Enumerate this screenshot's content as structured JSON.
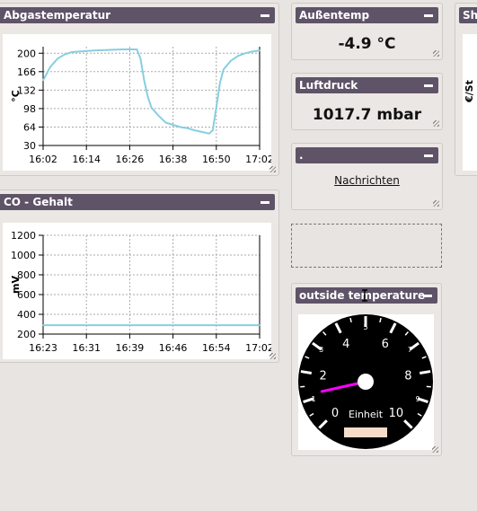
{
  "widgets": {
    "abgas": {
      "title": "Abgastemperatur"
    },
    "co": {
      "title": "CO - Gehalt"
    },
    "aussen": {
      "title": "Außentemp",
      "value": "-4.9 °C"
    },
    "luft": {
      "title": "Luftdruck",
      "value": "1017.7 mbar"
    },
    "nachrichten": {
      "title": ".",
      "link": "Nachrichten"
    },
    "outside": {
      "title": "outside temperature"
    },
    "partial": {
      "title": "Sh",
      "ylabel": "€/St"
    }
  },
  "gauge": {
    "major_labels": [
      "0",
      "2",
      "4",
      "6",
      "8",
      "10"
    ],
    "minor_labels": [
      "1",
      "3",
      "5",
      "7",
      "9"
    ],
    "unit": "Einheit",
    "needle_value": 1.2,
    "needle_color": "#ff00ff",
    "face_color": "#000000",
    "display_color": "#f7dcc9"
  },
  "chart_data": [
    {
      "type": "line",
      "title": "Abgastemperatur",
      "ylabel": "°C",
      "ylim": [
        30,
        212
      ],
      "yticks": [
        30,
        64,
        98,
        132,
        166,
        200
      ],
      "xticks": [
        "16:02",
        "16:14",
        "16:26",
        "16:38",
        "16:50",
        "17:02"
      ],
      "grid": true,
      "color": "#87cfe0",
      "x": [
        0,
        2,
        4,
        6,
        8,
        10,
        14,
        18,
        22,
        26,
        27,
        28,
        29,
        30,
        32,
        34,
        36,
        38,
        40,
        42,
        44,
        46,
        47,
        48,
        49,
        50,
        52,
        54,
        56,
        58,
        60
      ],
      "y": [
        150,
        175,
        190,
        198,
        202,
        203,
        205,
        206,
        207,
        207,
        190,
        150,
        120,
        100,
        85,
        72,
        68,
        64,
        62,
        58,
        55,
        52,
        58,
        100,
        145,
        170,
        186,
        195,
        200,
        203,
        205
      ]
    },
    {
      "type": "line",
      "title": "CO - Gehalt",
      "ylabel": "mV",
      "ylim": [
        200,
        1200
      ],
      "yticks": [
        200,
        400,
        600,
        800,
        1000,
        1200
      ],
      "xticks": [
        "16:23",
        "16:31",
        "16:39",
        "16:46",
        "16:54",
        "17:02"
      ],
      "grid": true,
      "color": "#87cfe0",
      "x": [
        0,
        39
      ],
      "y": [
        290,
        290
      ]
    }
  ]
}
